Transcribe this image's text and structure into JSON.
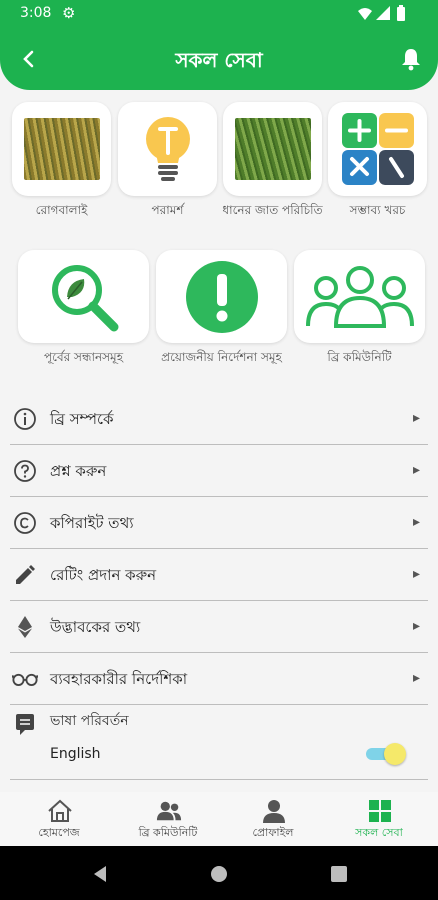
{
  "status": {
    "time": "3:08"
  },
  "header": {
    "title": "সকল সেবা"
  },
  "tiles_row1": [
    {
      "label": "রোগবালাই",
      "icon": "rice-field-photo"
    },
    {
      "label": "পরামর্শ",
      "icon": "lightbulb-icon"
    },
    {
      "label": "ধানের জাত পরিচিতি",
      "icon": "rice-plants-photo"
    },
    {
      "label": "সম্ভাব্য খরচ",
      "icon": "calculator-icon"
    }
  ],
  "tiles_row2": [
    {
      "label": "পূর্বের সন্ধানসমূহ",
      "icon": "search-history-icon"
    },
    {
      "label": "প্রয়োজনীয় নির্দেশনা সমূহ",
      "icon": "exclamation-icon"
    },
    {
      "label": "ব্রি কমিউনিটি",
      "icon": "community-icon"
    }
  ],
  "menu": [
    {
      "label": "ব্রি সম্পর্কে",
      "icon": "info-icon"
    },
    {
      "label": "প্রশ্ন করুন",
      "icon": "question-icon"
    },
    {
      "label": "কপিরাইট তথ্য",
      "icon": "copyright-icon"
    },
    {
      "label": "রেটিং প্রদান করুন",
      "icon": "pencil-icon"
    },
    {
      "label": "উদ্ভাবকের তথ্য",
      "icon": "ethereum-icon"
    },
    {
      "label": "ব্যবহারকারীর নির্দেশিকা",
      "icon": "glasses-icon"
    }
  ],
  "language": {
    "title": "ভাষা পরিবর্তন",
    "value": "English",
    "toggle_on": true
  },
  "bottom_nav": [
    {
      "label": "হোমপেজ",
      "icon": "home-icon",
      "active": false
    },
    {
      "label": "ব্রি কমিউনিটি",
      "icon": "community-icon",
      "active": false
    },
    {
      "label": "প্রোফাইল",
      "icon": "profile-icon",
      "active": false
    },
    {
      "label": "সকল সেবা",
      "icon": "grid-icon",
      "active": true
    }
  ],
  "colors": {
    "brand": "#1db24f",
    "accent_blue": "#2b83c6",
    "bulb_yellow": "#f9c74f"
  }
}
